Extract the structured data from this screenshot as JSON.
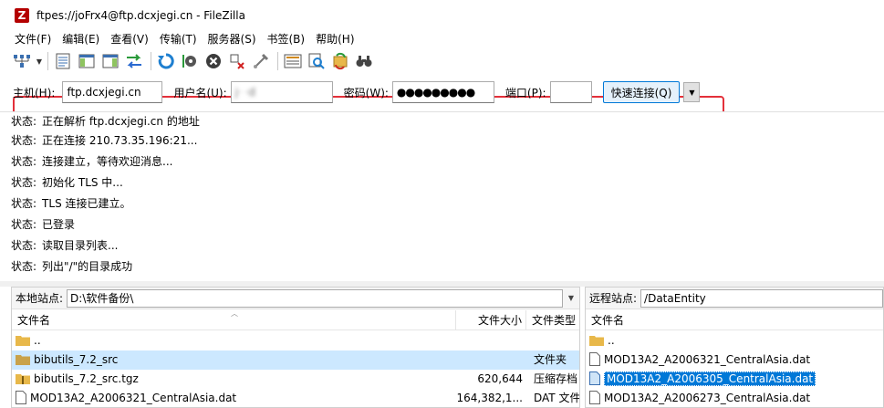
{
  "window": {
    "title": "ftpes://joFrx4@ftp.dcxjegi.cn - FileZilla",
    "app_icon_letter": "Z"
  },
  "menu": [
    "文件(F)",
    "编辑(E)",
    "查看(V)",
    "传输(T)",
    "服务器(S)",
    "书签(B)",
    "帮助(H)"
  ],
  "quickconnect": {
    "host_label": "主机(H):",
    "host_value": "ftp.dcxjegi.cn",
    "user_label": "用户名(U):",
    "user_value": "j·  ·d",
    "pass_label": "密码(W):",
    "pass_value": "●●●●●●●●●",
    "port_label": "端口(P):",
    "port_value": "",
    "connect_label": "快速连接(Q)"
  },
  "log": [
    {
      "k": "状态:",
      "v": "正在解析 ftp.dcxjegi.cn 的地址"
    },
    {
      "k": "状态:",
      "v": "正在连接 210.73.35.196:21..."
    },
    {
      "k": "状态:",
      "v": "连接建立，等待欢迎消息..."
    },
    {
      "k": "状态:",
      "v": "初始化 TLS 中..."
    },
    {
      "k": "状态:",
      "v": "TLS 连接已建立。"
    },
    {
      "k": "状态:",
      "v": "已登录"
    },
    {
      "k": "状态:",
      "v": "读取目录列表..."
    },
    {
      "k": "状态:",
      "v": "列出\"/\"的目录成功"
    }
  ],
  "local": {
    "site_label": "本地站点:",
    "path": "D:\\软件备份\\",
    "columns": {
      "name": "文件名",
      "size": "文件大小",
      "type": "文件类型"
    },
    "rows": [
      {
        "name": "..",
        "size": "",
        "type": "",
        "kind": "folder"
      },
      {
        "name": "bibutils_7.2_src",
        "size": "",
        "type": "文件夹",
        "kind": "folder"
      },
      {
        "name": "bibutils_7.2_src.tgz",
        "size": "620,644",
        "type": "压缩存档",
        "kind": "archive"
      },
      {
        "name": "MOD13A2_A2006321_CentralAsia.dat",
        "size": "164,382,1...",
        "type": "DAT 文件",
        "kind": "file"
      }
    ]
  },
  "remote": {
    "site_label": "远程站点:",
    "path": "/DataEntity",
    "columns": {
      "name": "文件名"
    },
    "rows": [
      {
        "name": "..",
        "kind": "folder"
      },
      {
        "name": "MOD13A2_A2006321_CentralAsia.dat",
        "kind": "file"
      },
      {
        "name": "MOD13A2_A2006305_CentralAsia.dat",
        "kind": "file"
      },
      {
        "name": "MOD13A2_A2006273_CentralAsia.dat",
        "kind": "file"
      }
    ]
  },
  "colors": {
    "accent": "#0078d7",
    "highlight": "#e3303a",
    "selection": "#cce8ff",
    "folder": "#e8b84a"
  }
}
